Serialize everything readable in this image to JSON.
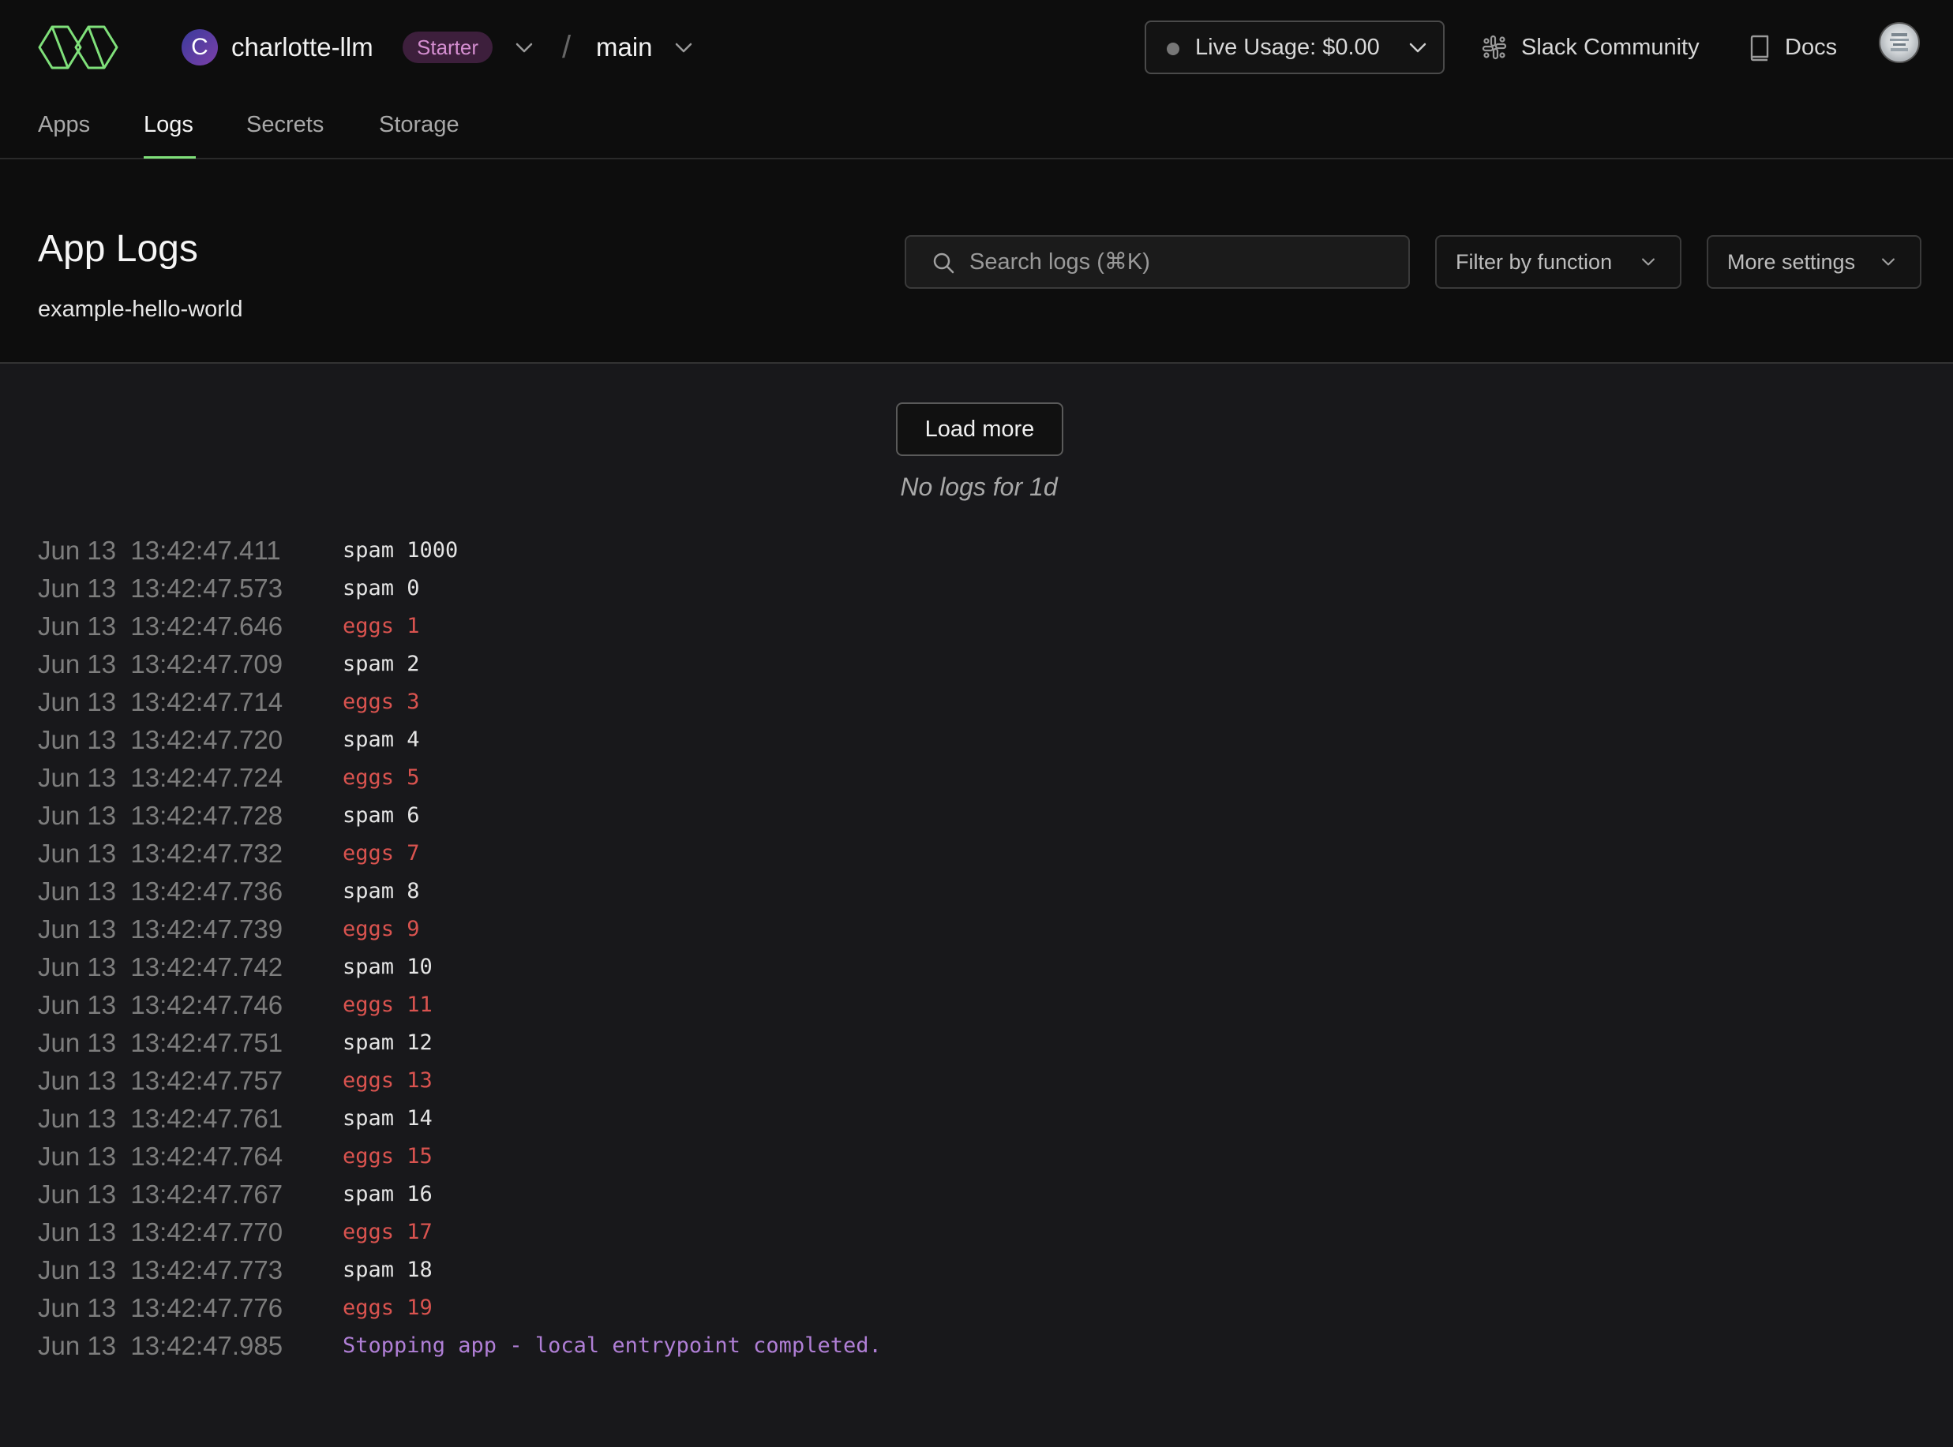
{
  "workspace": {
    "initial": "C",
    "name": "charlotte-llm",
    "plan": "Starter"
  },
  "environment": {
    "separator": "/",
    "name": "main"
  },
  "header": {
    "usage_label": "Live Usage: $0.00",
    "slack_label": "Slack Community",
    "docs_label": "Docs"
  },
  "nav": {
    "tabs": [
      {
        "label": "Apps"
      },
      {
        "label": "Logs",
        "active": true
      },
      {
        "label": "Secrets"
      },
      {
        "label": "Storage"
      }
    ]
  },
  "page": {
    "title": "App Logs",
    "subtitle": "example-hello-world"
  },
  "controls": {
    "search_placeholder": "Search logs (⌘K)",
    "filter_label": "Filter by function",
    "settings_label": "More settings",
    "load_more_label": "Load more",
    "empty_note": "No logs for 1d"
  },
  "logs": [
    {
      "timestamp": "Jun 13  13:42:47.411",
      "message": "spam 1000",
      "level": "stdout"
    },
    {
      "timestamp": "Jun 13  13:42:47.573",
      "message": "spam 0",
      "level": "stdout"
    },
    {
      "timestamp": "Jun 13  13:42:47.646",
      "message": "eggs 1",
      "level": "stderr"
    },
    {
      "timestamp": "Jun 13  13:42:47.709",
      "message": "spam 2",
      "level": "stdout"
    },
    {
      "timestamp": "Jun 13  13:42:47.714",
      "message": "eggs 3",
      "level": "stderr"
    },
    {
      "timestamp": "Jun 13  13:42:47.720",
      "message": "spam 4",
      "level": "stdout"
    },
    {
      "timestamp": "Jun 13  13:42:47.724",
      "message": "eggs 5",
      "level": "stderr"
    },
    {
      "timestamp": "Jun 13  13:42:47.728",
      "message": "spam 6",
      "level": "stdout"
    },
    {
      "timestamp": "Jun 13  13:42:47.732",
      "message": "eggs 7",
      "level": "stderr"
    },
    {
      "timestamp": "Jun 13  13:42:47.736",
      "message": "spam 8",
      "level": "stdout"
    },
    {
      "timestamp": "Jun 13  13:42:47.739",
      "message": "eggs 9",
      "level": "stderr"
    },
    {
      "timestamp": "Jun 13  13:42:47.742",
      "message": "spam 10",
      "level": "stdout"
    },
    {
      "timestamp": "Jun 13  13:42:47.746",
      "message": "eggs 11",
      "level": "stderr"
    },
    {
      "timestamp": "Jun 13  13:42:47.751",
      "message": "spam 12",
      "level": "stdout"
    },
    {
      "timestamp": "Jun 13  13:42:47.757",
      "message": "eggs 13",
      "level": "stderr"
    },
    {
      "timestamp": "Jun 13  13:42:47.761",
      "message": "spam 14",
      "level": "stdout"
    },
    {
      "timestamp": "Jun 13  13:42:47.764",
      "message": "eggs 15",
      "level": "stderr"
    },
    {
      "timestamp": "Jun 13  13:42:47.767",
      "message": "spam 16",
      "level": "stdout"
    },
    {
      "timestamp": "Jun 13  13:42:47.770",
      "message": "eggs 17",
      "level": "stderr"
    },
    {
      "timestamp": "Jun 13  13:42:47.773",
      "message": "spam 18",
      "level": "stdout"
    },
    {
      "timestamp": "Jun 13  13:42:47.776",
      "message": "eggs 19",
      "level": "stderr"
    },
    {
      "timestamp": "Jun 13  13:42:47.985",
      "message": "Stopping app - local entrypoint completed.",
      "level": "system"
    }
  ],
  "icons": {
    "logo": "modal-logo-icon",
    "slack": "slack-icon",
    "docs": "book-icon",
    "search": "search-icon",
    "chevron": "chevron-down-icon"
  },
  "colors": {
    "brand_green": "#7fe07a",
    "stderr_red": "#d9534f",
    "system_purple": "#b07fd6",
    "plan_badge_text": "#d48ed0"
  }
}
